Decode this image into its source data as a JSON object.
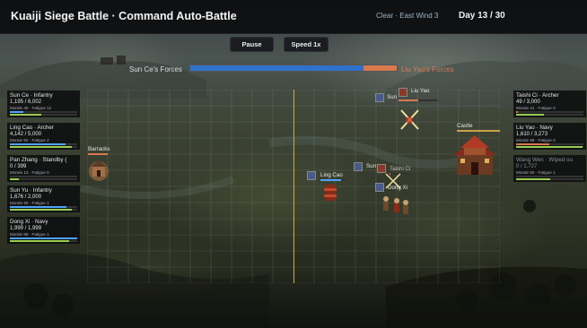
{
  "header": {
    "title": "Kuaiji Siege Battle · Command Auto-Battle",
    "weather": "Clear · East Wind 3",
    "day": "Day 13 / 30"
  },
  "controls": {
    "pause_label": "Pause",
    "speed_label": "Speed 1x"
  },
  "forces": {
    "left_name": "Sun Ce's Forces",
    "right_name": "Liu Yao's Forces",
    "left_share": 0.84,
    "left_color": "#2f72c9",
    "right_color": "#d9794e"
  },
  "left_units": [
    {
      "name": "Sun Ce · Infantry",
      "hp": "1,195 / 6,002",
      "stats": "Morale 46 · Fatigue 12",
      "hp_frac": 0.2,
      "morale_frac": 0.46,
      "color": "#4fa3ff"
    },
    {
      "name": "Ling Cao · Archer",
      "hp": "4,142 / 5,000",
      "stats": "Morale 92 · Fatigue 2",
      "hp_frac": 0.83,
      "morale_frac": 0.92,
      "color": "#4fa3ff"
    },
    {
      "name": "Pan Zhang · Standby (",
      "hp": "0 / 399",
      "stats": "Morale 13 · Fatigue 0",
      "hp_frac": 0.0,
      "morale_frac": 0.13,
      "color": "#4fa3ff"
    },
    {
      "name": "Sun Yu · Infantry",
      "hp": "1,676 / 2,000",
      "stats": "Morale 92 · Fatigue 1",
      "hp_frac": 0.84,
      "morale_frac": 0.92,
      "color": "#4fa3ff"
    },
    {
      "name": "Dong Xi · Navy",
      "hp": "1,999 / 1,999",
      "stats": "Morale 88 · Fatigue 1",
      "hp_frac": 1.0,
      "morale_frac": 0.88,
      "color": "#4fa3ff"
    }
  ],
  "right_units": [
    {
      "name": "Taishi Ci · Archer",
      "hp": "49 / 3,000",
      "stats": "Morale 41 · Fatigue 0",
      "hp_frac": 0.02,
      "morale_frac": 0.41,
      "color": "#d9794e"
    },
    {
      "name": "Liu Yao · Navy",
      "hp": "1,610 / 3,273",
      "stats": "Morale 99 · Fatigue 0",
      "hp_frac": 0.49,
      "morale_frac": 0.99,
      "color": "#d9794e"
    },
    {
      "name": "Wang Wen · Wiped ou",
      "hp": "0 / 1,727",
      "stats": "Morale 50 · Fatigue 1",
      "hp_frac": 0.0,
      "morale_frac": 0.5,
      "color": "#d9794e",
      "dim": true
    }
  ],
  "map": {
    "barracks_label": "Barracks",
    "castle_label": "Castle",
    "units": [
      {
        "label": "Sun",
        "side": "left"
      },
      {
        "label": "Liu Yao",
        "side": "right"
      },
      {
        "label": "Ling Cao",
        "side": "left"
      },
      {
        "label": "Sun",
        "side": "left"
      },
      {
        "label": "Taishi Ci",
        "side": "right"
      },
      {
        "label": "Dong Xi",
        "side": "left"
      }
    ]
  }
}
